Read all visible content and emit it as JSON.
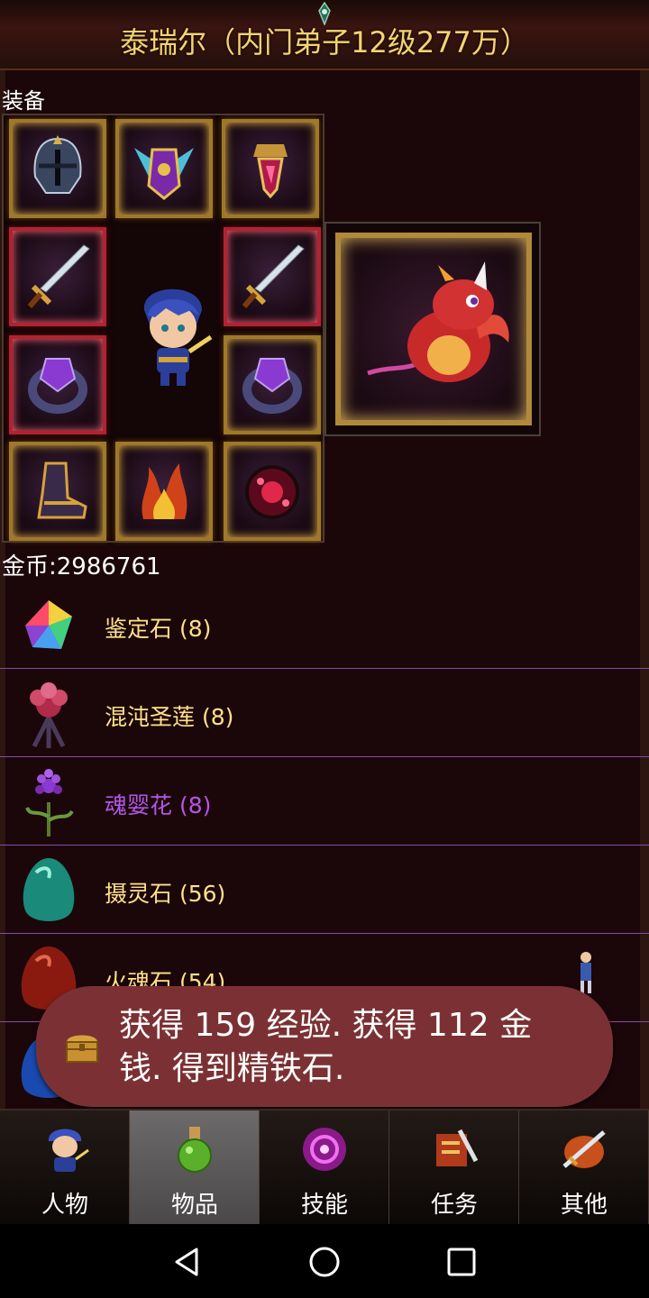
{
  "header": {
    "title": "泰瑞尔（内门弟子12级277万）"
  },
  "equipment": {
    "label": "装备",
    "slots": [
      {
        "name": "helmet-icon",
        "frame": "gold"
      },
      {
        "name": "wings-armor-icon",
        "frame": "gold"
      },
      {
        "name": "amulet-icon",
        "frame": "gold"
      },
      {
        "name": "sword-icon",
        "frame": "red"
      },
      {
        "name": "sword-icon",
        "frame": "red"
      },
      {
        "name": "ring-icon",
        "frame": "red"
      },
      {
        "name": "ring-icon",
        "frame": "gold"
      },
      {
        "name": "boots-icon",
        "frame": "gold"
      },
      {
        "name": "flame-belt-icon",
        "frame": "gold"
      },
      {
        "name": "gem-orb-icon",
        "frame": "gold"
      }
    ],
    "pet": "red-dragon-icon"
  },
  "gold_text": "金币:2986761",
  "items": [
    {
      "name": "鉴定石 (8)",
      "icon": "rainbow-crystal-icon",
      "color": "#ffe08a"
    },
    {
      "name": "混沌圣莲 (8)",
      "icon": "chaos-lotus-icon",
      "color": "#ffe08a"
    },
    {
      "name": "魂婴花 (8)",
      "icon": "soul-flower-icon",
      "color": "#b455e6"
    },
    {
      "name": "摄灵石 (56)",
      "icon": "green-egg-stone-icon",
      "color": "#ffe08a"
    },
    {
      "name": "火魂石 (54)",
      "icon": "red-egg-stone-icon",
      "color": "#ffe08a"
    }
  ],
  "toast": {
    "message": "获得 159 经验. 获得 112 金钱. 得到精铁石."
  },
  "tabs": [
    {
      "label": "人物",
      "icon": "hero-icon",
      "active": false
    },
    {
      "label": "物品",
      "icon": "potion-icon",
      "active": true
    },
    {
      "label": "技能",
      "icon": "magic-orb-icon",
      "active": false
    },
    {
      "label": "任务",
      "icon": "quest-scroll-icon",
      "active": false
    },
    {
      "label": "其他",
      "icon": "sword-shield-icon",
      "active": false
    }
  ],
  "colors": {
    "title_gold": "#f4d372",
    "item_text": "#ffe08a",
    "highlight_purple": "#b455e6",
    "toast_bg": "#7b3133",
    "divider": "#8a4aa8"
  }
}
